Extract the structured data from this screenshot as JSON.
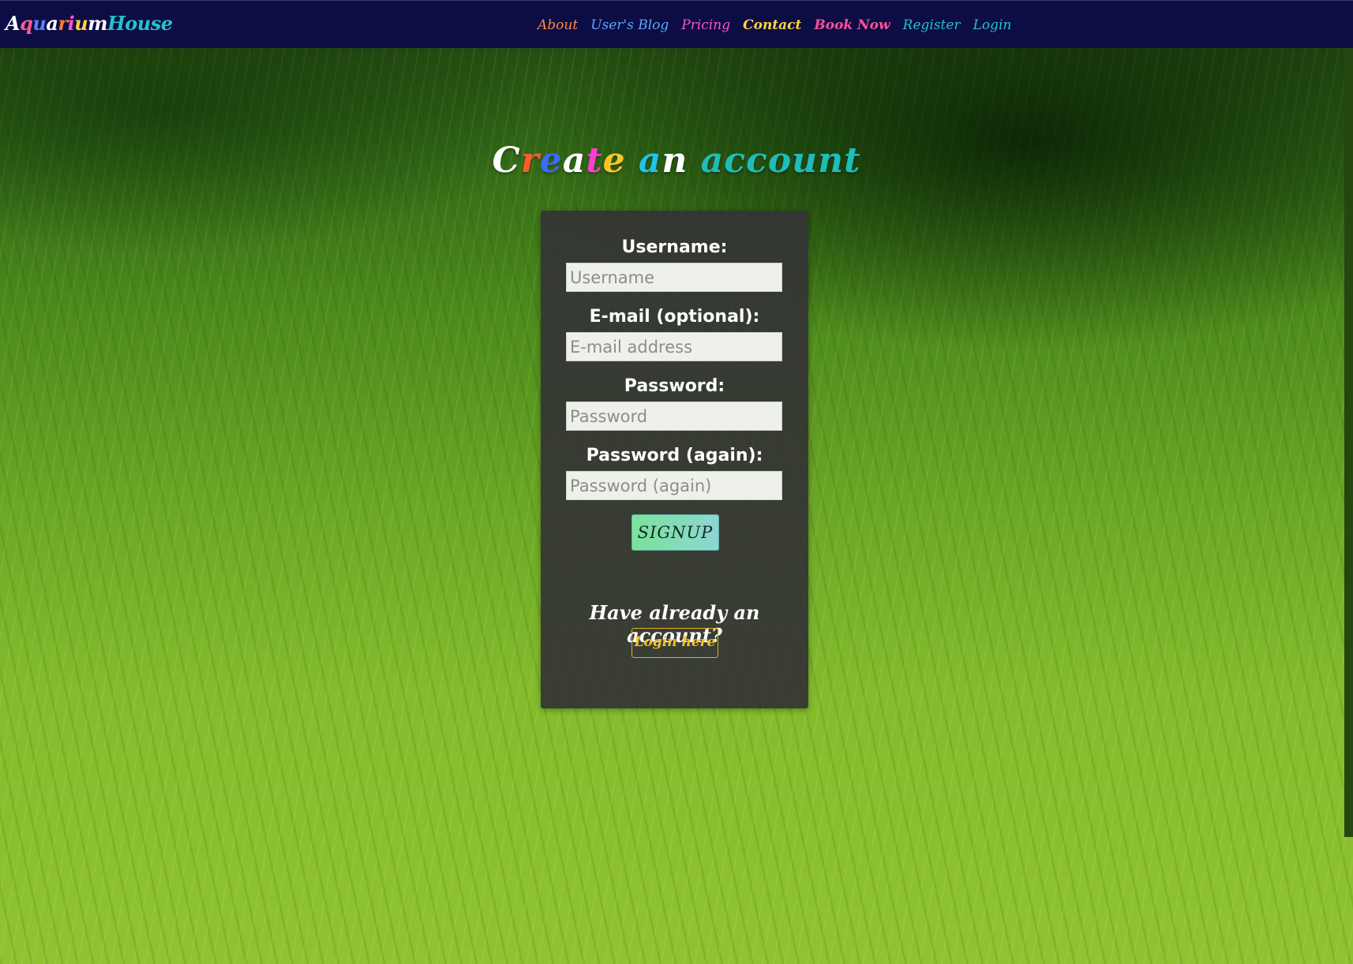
{
  "brand": {
    "parts": [
      {
        "text": "A",
        "color": "#ffffff"
      },
      {
        "text": "q",
        "color": "#ff5a8c"
      },
      {
        "text": "u",
        "color": "#5d7dff"
      },
      {
        "text": "a",
        "color": "#ffffff"
      },
      {
        "text": "r",
        "color": "#ff7a2f"
      },
      {
        "text": "i",
        "color": "#ff4fd8"
      },
      {
        "text": "u",
        "color": "#ffd23f"
      },
      {
        "text": "m",
        "color": "#ffffff"
      },
      {
        "text": "House",
        "color": "#26c2c9"
      }
    ]
  },
  "nav": {
    "items": [
      {
        "label": "About",
        "color": "#ff8a3d",
        "bold": false
      },
      {
        "label": "User's Blog",
        "color": "#5aa8ff",
        "bold": false
      },
      {
        "label": "Pricing",
        "color": "#ff4fd8",
        "bold": false
      },
      {
        "label": "Contact",
        "color": "#ffd23f",
        "bold": true
      },
      {
        "label": "Book Now",
        "color": "#ff4f9a",
        "bold": true
      },
      {
        "label": "Register",
        "color": "#26c2c9",
        "bold": false
      },
      {
        "label": "Login",
        "color": "#26c2c9",
        "bold": false
      }
    ]
  },
  "title": {
    "parts": [
      {
        "text": "C",
        "color": "#ffffff"
      },
      {
        "text": "r",
        "color": "#ff5a2a"
      },
      {
        "text": "e",
        "color": "#3c6bff"
      },
      {
        "text": "a",
        "color": "#ffffff"
      },
      {
        "text": "t",
        "color": "#ff3fd0"
      },
      {
        "text": "e",
        "color": "#ffc42a"
      },
      {
        "text": " ",
        "color": "#ffffff"
      },
      {
        "text": "a",
        "color": "#1fc3e8"
      },
      {
        "text": "n",
        "color": "#ffffff"
      },
      {
        "text": " ",
        "color": "#ffffff"
      },
      {
        "text": "account",
        "color": "#1fbcb8"
      }
    ]
  },
  "form": {
    "username_label": "Username:",
    "username_placeholder": "Username",
    "email_label": "E-mail (optional):",
    "email_placeholder": "E-mail address",
    "password_label": "Password:",
    "password_placeholder": "Password",
    "password2_label": "Password (again):",
    "password2_placeholder": "Password (again)",
    "signup_label": "SIGNUP"
  },
  "login_prompt": {
    "text": "Have already an account?",
    "link_label": "Login here"
  }
}
